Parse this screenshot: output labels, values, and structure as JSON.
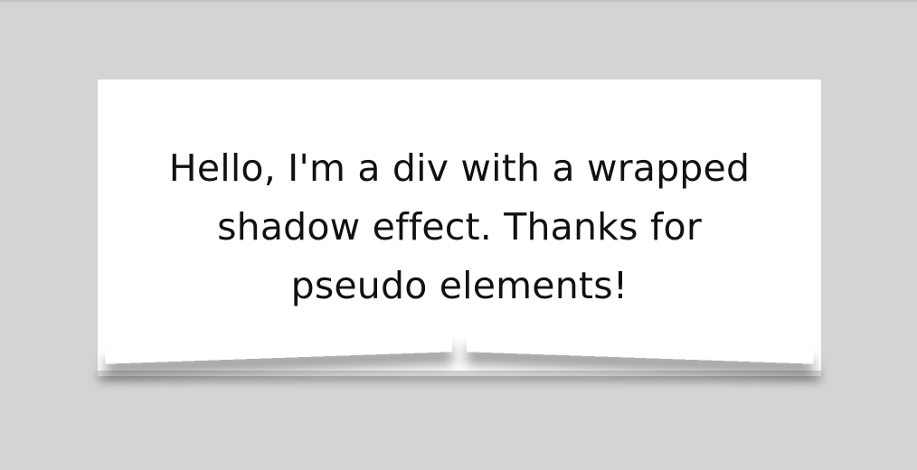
{
  "card": {
    "text": "Hello, I'm a div with a wrapped shadow effect. Thanks for pseudo elements!"
  },
  "colors": {
    "background": "#d4d4d4",
    "card": "#ffffff",
    "text": "#111111",
    "shadow": "#000000"
  }
}
